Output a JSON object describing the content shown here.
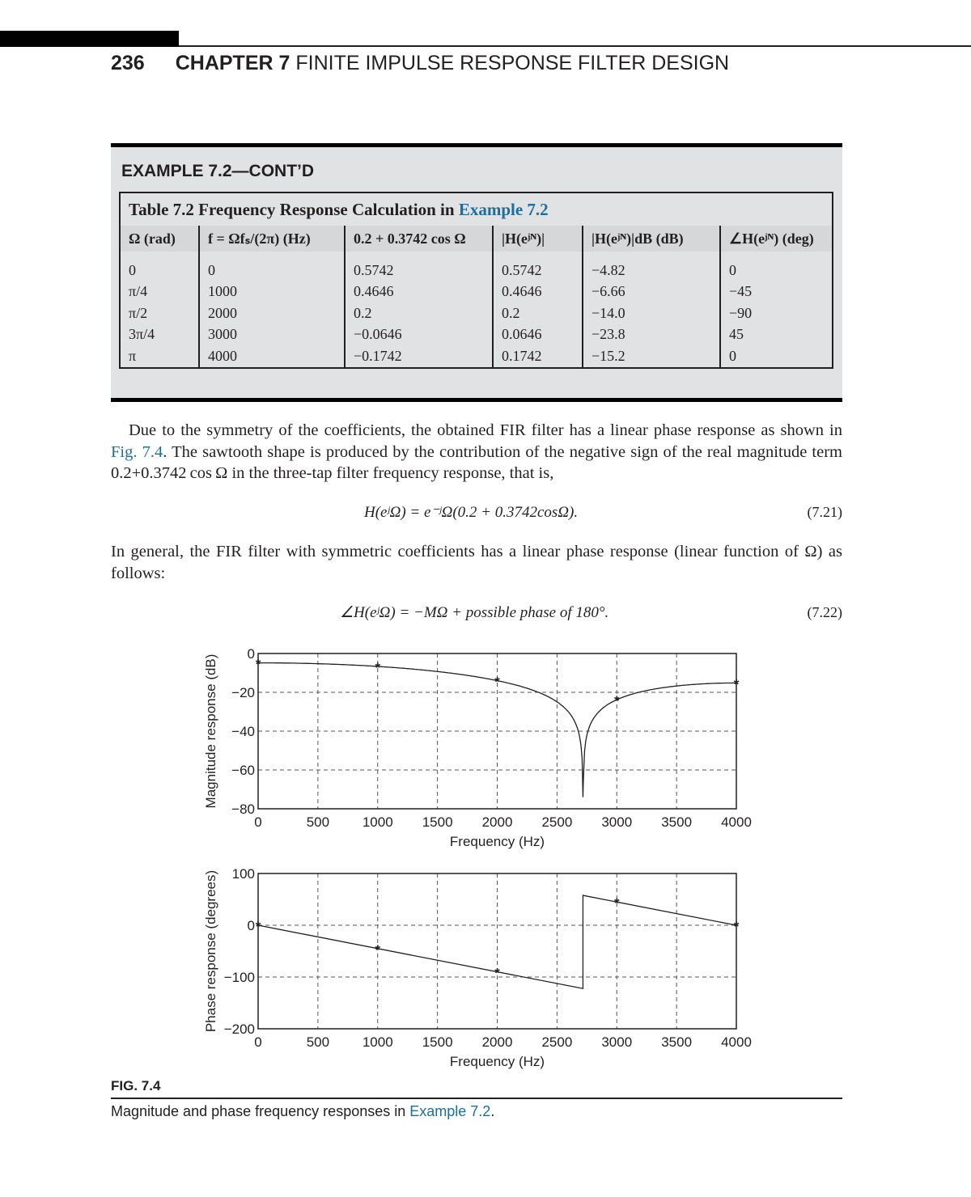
{
  "header": {
    "page_number": "236",
    "chapter_label": "CHAPTER 7",
    "chapter_title": "FINITE IMPULSE RESPONSE FILTER DESIGN"
  },
  "example": {
    "title": "EXAMPLE 7.2—CONT’D",
    "table": {
      "caption_prefix": "Table 7.2  Frequency Response Calculation in ",
      "caption_link": "Example 7.2",
      "columns": [
        "Ω (rad)",
        "f = Ωfₛ/(2π) (Hz)",
        "0.2 + 0.3742 cos Ω",
        "|H(eʲᴺ)|",
        "|H(eʲᴺ)|dB (dB)",
        "∠H(eʲᴺ) (deg)"
      ],
      "rows": [
        [
          "0",
          "0",
          "0.5742",
          "0.5742",
          "−4.82",
          "0"
        ],
        [
          "π/4",
          "1000",
          "0.4646",
          "0.4646",
          "−6.66",
          "−45"
        ],
        [
          "π/2",
          "2000",
          "0.2",
          "0.2",
          "−14.0",
          "−90"
        ],
        [
          "3π/4",
          "3000",
          "−0.0646",
          "0.0646",
          "−23.8",
          "45"
        ],
        [
          "π",
          "4000",
          "−0.1742",
          "0.1742",
          "−15.2",
          "0"
        ]
      ]
    }
  },
  "body": {
    "para1_a": "Due to the symmetry of the coefficients, the obtained FIR filter has a linear phase response as shown in ",
    "para1_link": "Fig. 7.4",
    "para1_b": ". The sawtooth shape is produced by the contribution of the negative sign of the real magnitude term 0.2+0.3742 cos Ω in the three-tap filter frequency response, that is,",
    "eq1": "H(eʲΩ) = e⁻ʲΩ(0.2 + 0.3742cosΩ).",
    "eq1_num": "(7.21)",
    "para2": "In general, the FIR filter with symmetric coefficients has a linear phase response (linear function of Ω) as follows:",
    "eq2": "∠H(eʲΩ) = −MΩ + possible phase of 180°.",
    "eq2_num": "(7.22)"
  },
  "figure": {
    "label": "FIG. 7.4",
    "caption_prefix": "Magnitude and phase frequency responses in ",
    "caption_link": "Example 7.2",
    "caption_suffix": "."
  },
  "chart_data": [
    {
      "type": "line",
      "title": "",
      "xlabel": "Frequency (Hz)",
      "ylabel": "Magnitude response (dB)",
      "xlim": [
        0,
        4000
      ],
      "ylim": [
        -80,
        0
      ],
      "xticks": [
        0,
        500,
        1000,
        1500,
        2000,
        2500,
        3000,
        3500,
        4000
      ],
      "yticks": [
        0,
        -20,
        -40,
        -60,
        -80
      ],
      "ytick_labels": [
        "0",
        "−20",
        "−40",
        "−60",
        "−80"
      ],
      "grid": true,
      "legend": "none",
      "series": [
        {
          "name": "magnitude curve",
          "formula": "20*log10(|0.2+0.3742*cos(2*pi*f/8000)|)",
          "x_samples": 400,
          "min_clip_db": -74
        },
        {
          "name": "calculated points",
          "marker": "*",
          "x": [
            0,
            1000,
            2000,
            3000,
            4000
          ],
          "y": [
            -4.82,
            -6.66,
            -14.0,
            -23.8,
            -15.2
          ]
        }
      ],
      "notch_hz": 2717
    },
    {
      "type": "line",
      "title": "",
      "xlabel": "Frequency (Hz)",
      "ylabel": "Phase response (degrees)",
      "xlim": [
        0,
        4000
      ],
      "ylim": [
        -200,
        100
      ],
      "xticks": [
        0,
        500,
        1000,
        1500,
        2000,
        2500,
        3000,
        3500,
        4000
      ],
      "yticks": [
        100,
        0,
        -100,
        -200
      ],
      "ytick_labels": [
        "100",
        "0",
        "−100",
        "−200"
      ],
      "grid": true,
      "legend": "none",
      "series": [
        {
          "name": "phase curve",
          "x": [
            0,
            2717,
            2717,
            4000
          ],
          "y": [
            0,
            -122.3,
            57.7,
            0
          ]
        },
        {
          "name": "calculated points",
          "marker": "*",
          "x": [
            0,
            1000,
            2000,
            3000,
            4000
          ],
          "y": [
            0,
            -45,
            -90,
            45,
            0
          ]
        }
      ]
    }
  ]
}
